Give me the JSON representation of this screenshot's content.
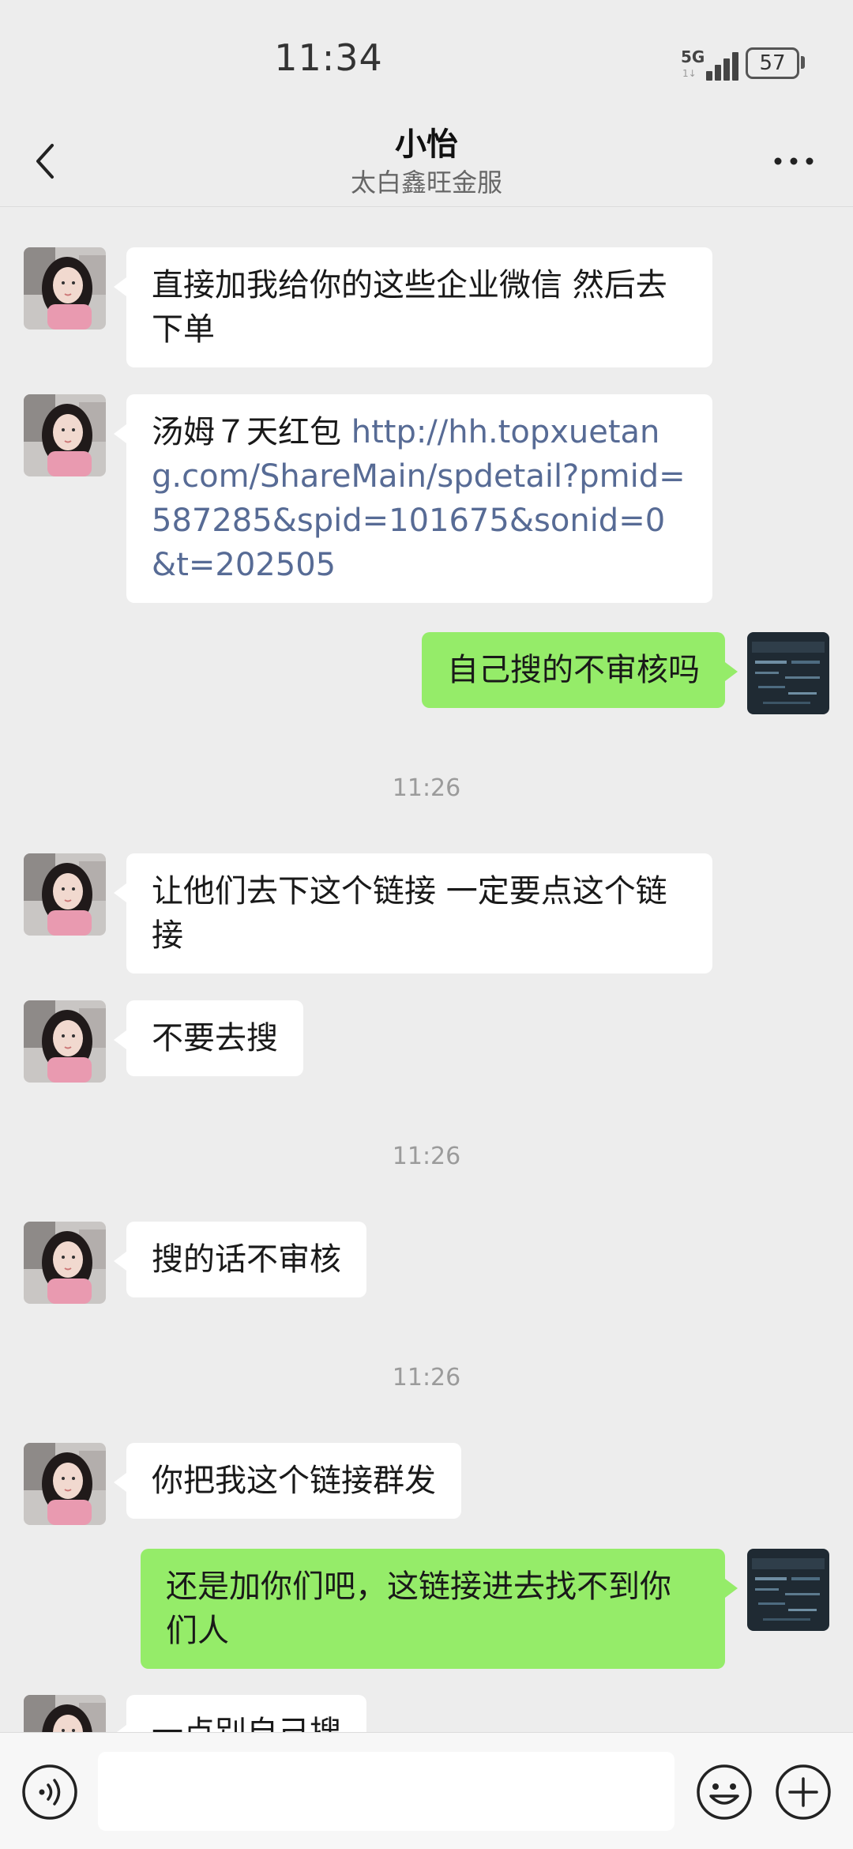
{
  "status_bar": {
    "time": "11:34",
    "network": "5G",
    "network_sub": "1↓",
    "battery": "57"
  },
  "header": {
    "title": "小怡",
    "subtitle": "太白鑫旺金服"
  },
  "messages": [
    {
      "from": "them",
      "text": "直接加我给你的这些企业微信 然后去下单"
    },
    {
      "from": "them",
      "prefix": "汤姆７天红包 ",
      "link": "http://hh.topxuetang.com/ShareMain/spdetail?pmid=587285&spid=101675&sonid=0&t=202505"
    },
    {
      "from": "me",
      "text": "自己搜的不审核吗"
    },
    {
      "timestamp": "11:26"
    },
    {
      "from": "them",
      "text": "让他们去下这个链接  一定要点这个链接"
    },
    {
      "from": "them",
      "text": "不要去搜"
    },
    {
      "timestamp": "11:26"
    },
    {
      "from": "them",
      "text": "搜的话不审核"
    },
    {
      "timestamp": "11:26"
    },
    {
      "from": "them",
      "text": "你把我这个链接群发"
    },
    {
      "from": "me",
      "text": "还是加你们吧，这链接进去找不到你们人"
    },
    {
      "from": "them",
      "text": "一点别自己搜"
    }
  ],
  "input": {
    "placeholder": ""
  },
  "colors": {
    "background": "#ededed",
    "my_bubble": "#95ec69",
    "their_bubble": "#ffffff",
    "link": "#576b95"
  }
}
